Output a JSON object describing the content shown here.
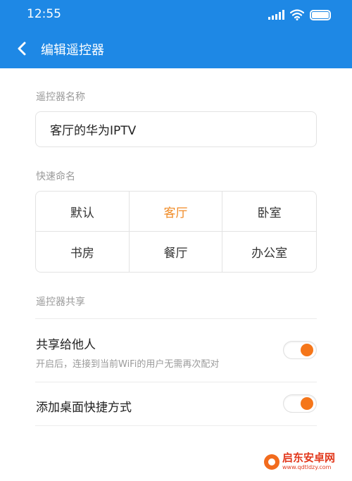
{
  "status_bar": {
    "time": "12:55"
  },
  "toolbar": {
    "title": "编辑遥控器"
  },
  "remote_name": {
    "label": "遥控器名称",
    "value": "客厅的华为IPTV"
  },
  "quick_naming": {
    "label": "快速命名",
    "options": [
      "默认",
      "客厅",
      "卧室",
      "书房",
      "餐厅",
      "办公室"
    ],
    "selected": "客厅"
  },
  "sharing": {
    "section_label": "遥控器共享",
    "share": {
      "title": "共享给他人",
      "description": "开启后，连接到当前WiFi的用户无需再次配对",
      "enabled": true
    },
    "shortcut": {
      "title": "添加桌面快捷方式",
      "enabled": true
    }
  },
  "colors": {
    "header": "#1e88e5",
    "accent": "#f5761a",
    "selected_text": "#f08a24"
  },
  "watermark": {
    "title": "启东安卓网",
    "url": "www.qdtldzy.com"
  }
}
